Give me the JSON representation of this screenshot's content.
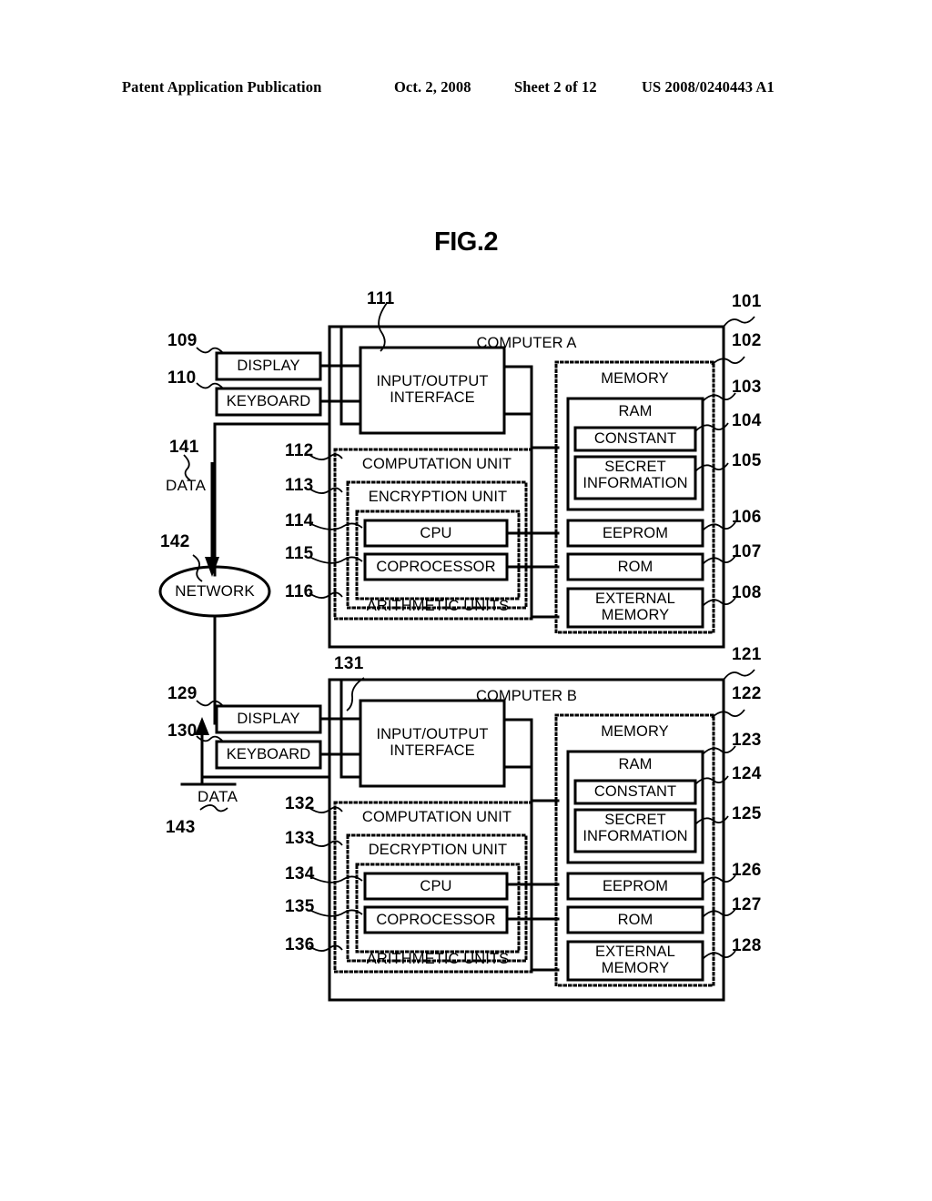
{
  "header": {
    "publication": "Patent Application Publication",
    "date": "Oct. 2, 2008",
    "sheet": "Sheet 2 of 12",
    "patent_number": "US 2008/0240443 A1"
  },
  "figure": {
    "title": "FIG.2"
  },
  "network": {
    "label": "NETWORK",
    "ref": "142"
  },
  "flows": [
    {
      "ref": "141",
      "label": "DATA",
      "direction": "down"
    },
    {
      "ref": "143",
      "label": "DATA",
      "direction": "up"
    }
  ],
  "computer_a": {
    "title": "COMPUTER A",
    "ref": "101",
    "peripherals": [
      {
        "label": "DISPLAY",
        "ref": "109"
      },
      {
        "label": "KEYBOARD",
        "ref": "110"
      }
    ],
    "io_interface": {
      "line1": "INPUT/OUTPUT",
      "line2": "INTERFACE",
      "ref": "111"
    },
    "computation_unit": {
      "label": "COMPUTATION UNIT",
      "ref": "112",
      "crypto_unit": {
        "label": "ENCRYPTION UNIT",
        "ref": "113"
      },
      "arithmetic_units": {
        "label": "ARITHMETIC UNITS",
        "ref": "116"
      },
      "processors": [
        {
          "label": "CPU",
          "ref": "114"
        },
        {
          "label": "COPROCESSOR",
          "ref": "115"
        }
      ]
    },
    "memory": {
      "label": "MEMORY",
      "ref": "102",
      "ram": {
        "label": "RAM",
        "ref": "103",
        "regions": [
          {
            "label": "CONSTANT",
            "ref": "104"
          },
          {
            "label": "SECRET INFORMATION",
            "line1": "SECRET",
            "line2": "INFORMATION",
            "ref": "105"
          }
        ]
      },
      "devices": [
        {
          "label": "EEPROM",
          "ref": "106"
        },
        {
          "label": "ROM",
          "ref": "107"
        },
        {
          "label": "EXTERNAL MEMORY",
          "line1": "EXTERNAL",
          "line2": "MEMORY",
          "ref": "108"
        }
      ]
    }
  },
  "computer_b": {
    "title": "COMPUTER B",
    "ref": "121",
    "peripherals": [
      {
        "label": "DISPLAY",
        "ref": "129"
      },
      {
        "label": "KEYBOARD",
        "ref": "130"
      }
    ],
    "io_interface": {
      "line1": "INPUT/OUTPUT",
      "line2": "INTERFACE",
      "ref": "131"
    },
    "computation_unit": {
      "label": "COMPUTATION UNIT",
      "ref": "132",
      "crypto_unit": {
        "label": "DECRYPTION UNIT",
        "ref": "133"
      },
      "arithmetic_units": {
        "label": "ARITHMETIC UNITS",
        "ref": "136"
      },
      "processors": [
        {
          "label": "CPU",
          "ref": "134"
        },
        {
          "label": "COPROCESSOR",
          "ref": "135"
        }
      ]
    },
    "memory": {
      "label": "MEMORY",
      "ref": "122",
      "ram": {
        "label": "RAM",
        "ref": "123",
        "regions": [
          {
            "label": "CONSTANT",
            "ref": "124"
          },
          {
            "label": "SECRET INFORMATION",
            "line1": "SECRET",
            "line2": "INFORMATION",
            "ref": "125"
          }
        ]
      },
      "devices": [
        {
          "label": "EEPROM",
          "ref": "126"
        },
        {
          "label": "ROM",
          "ref": "127"
        },
        {
          "label": "EXTERNAL MEMORY",
          "line1": "EXTERNAL",
          "line2": "MEMORY",
          "ref": "128"
        }
      ]
    }
  },
  "colors": {
    "ink": "#000000",
    "paper": "#ffffff"
  }
}
